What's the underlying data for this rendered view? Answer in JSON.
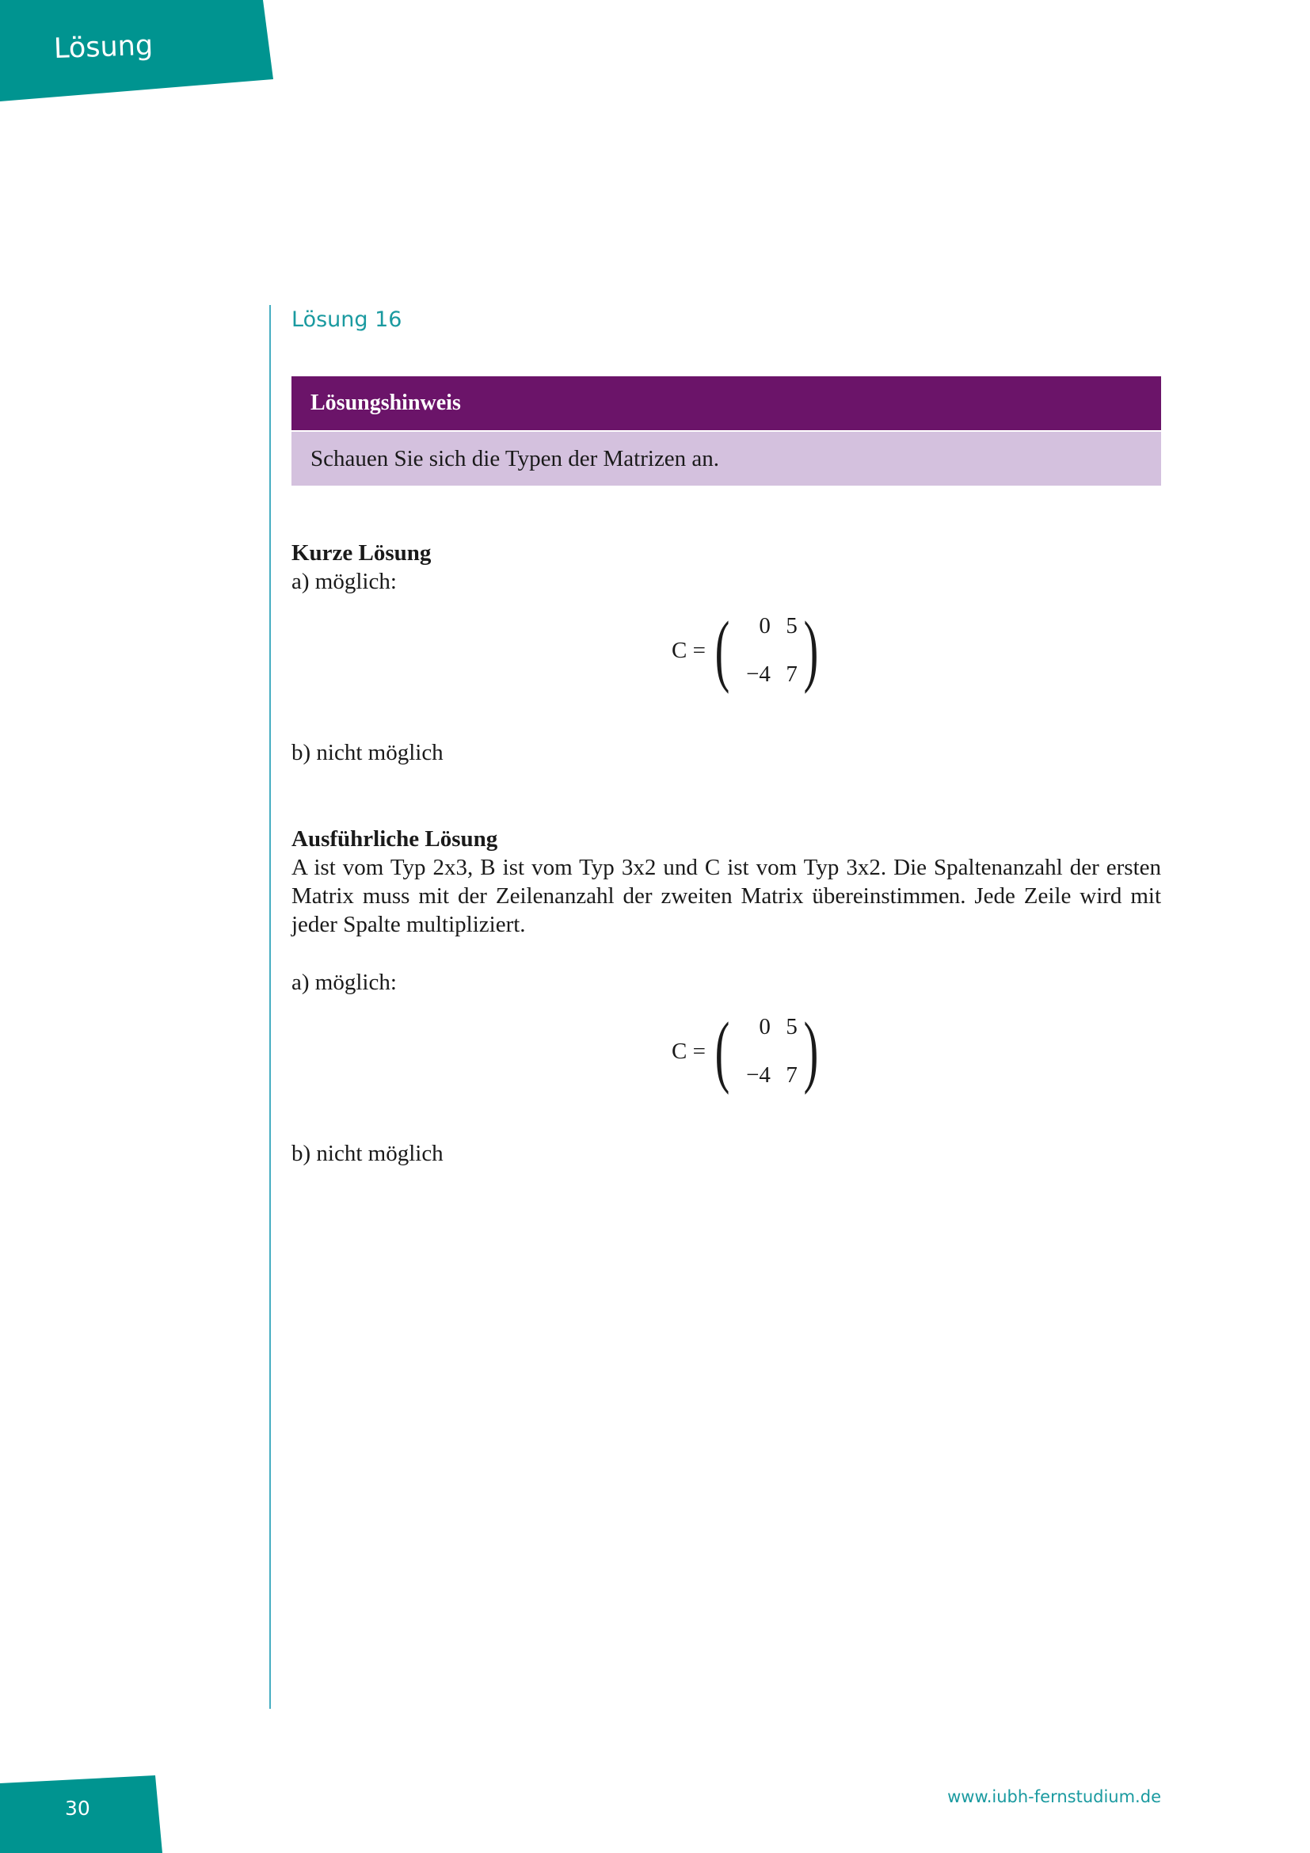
{
  "header": {
    "tab_label": "Lösung"
  },
  "section": {
    "title": "Lösung 16"
  },
  "hint": {
    "title": "Lösungshinweis",
    "text": "Schauen Sie sich die Typen der Matrizen an."
  },
  "short_solution": {
    "heading": "Kurze Lösung",
    "part_a": "a) möglich:",
    "matrix": {
      "lhs": "C =",
      "cells": [
        "0",
        "5",
        "−4",
        "7"
      ]
    },
    "part_b": "b) nicht möglich"
  },
  "detailed_solution": {
    "heading": "Ausführliche Lösung",
    "paragraph": "A ist vom Typ 2x3, B ist vom Typ 3x2 und C ist vom Typ 3x2. Die Spaltenanzahl der ersten Matrix muss mit der Zeilenanzahl der zweiten Matrix übereinstimmen. Jede Zeile wird mit jeder Spalte multipliziert.",
    "part_a": "a) möglich:",
    "matrix": {
      "lhs": "C =",
      "cells": [
        "0",
        "5",
        "−4",
        "7"
      ]
    },
    "part_b": "b) nicht möglich"
  },
  "footer": {
    "page_number": "30",
    "url": "www.iubh-fernstudium.de"
  }
}
